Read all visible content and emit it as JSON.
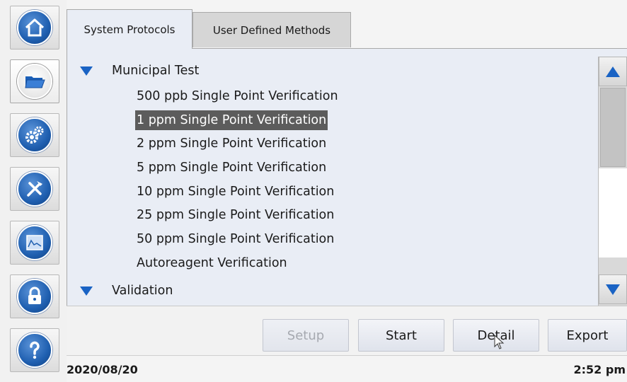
{
  "sidebar": {
    "items": [
      {
        "icon": "home-icon",
        "active": false
      },
      {
        "icon": "folder-icon",
        "active": true
      },
      {
        "icon": "settings-gears-icon",
        "active": false
      },
      {
        "icon": "tools-icon",
        "active": false
      },
      {
        "icon": "chart-icon",
        "active": false
      },
      {
        "icon": "lock-icon",
        "active": false
      },
      {
        "icon": "help-icon",
        "active": false
      }
    ]
  },
  "tabs": {
    "system_protocols": "System Protocols",
    "user_defined_methods": "User Defined Methods",
    "active": "System Protocols"
  },
  "tree": {
    "groups": [
      {
        "label": "Municipal Test",
        "expanded": true,
        "items": [
          "500 ppb Single Point Verification",
          "1 ppm Single Point Verification",
          "2 ppm Single Point Verification",
          "5 ppm Single Point Verification",
          "10 ppm Single Point Verification",
          "25 ppm Single Point Verification",
          "50 ppm Single Point Verification",
          "Autoreagent Verification"
        ]
      },
      {
        "label": "Validation",
        "expanded": true,
        "items": []
      }
    ],
    "selected_item": "1 ppm Single Point Verification"
  },
  "actions": {
    "setup": "Setup",
    "start": "Start",
    "detail": "Detail",
    "export": "Export"
  },
  "status": {
    "date": "2020/08/20",
    "time": "2:52 pm"
  },
  "colors": {
    "accent_blue": "#1a63c4",
    "selection": "#5c5c5c",
    "panel_bg": "#e9edf5"
  }
}
